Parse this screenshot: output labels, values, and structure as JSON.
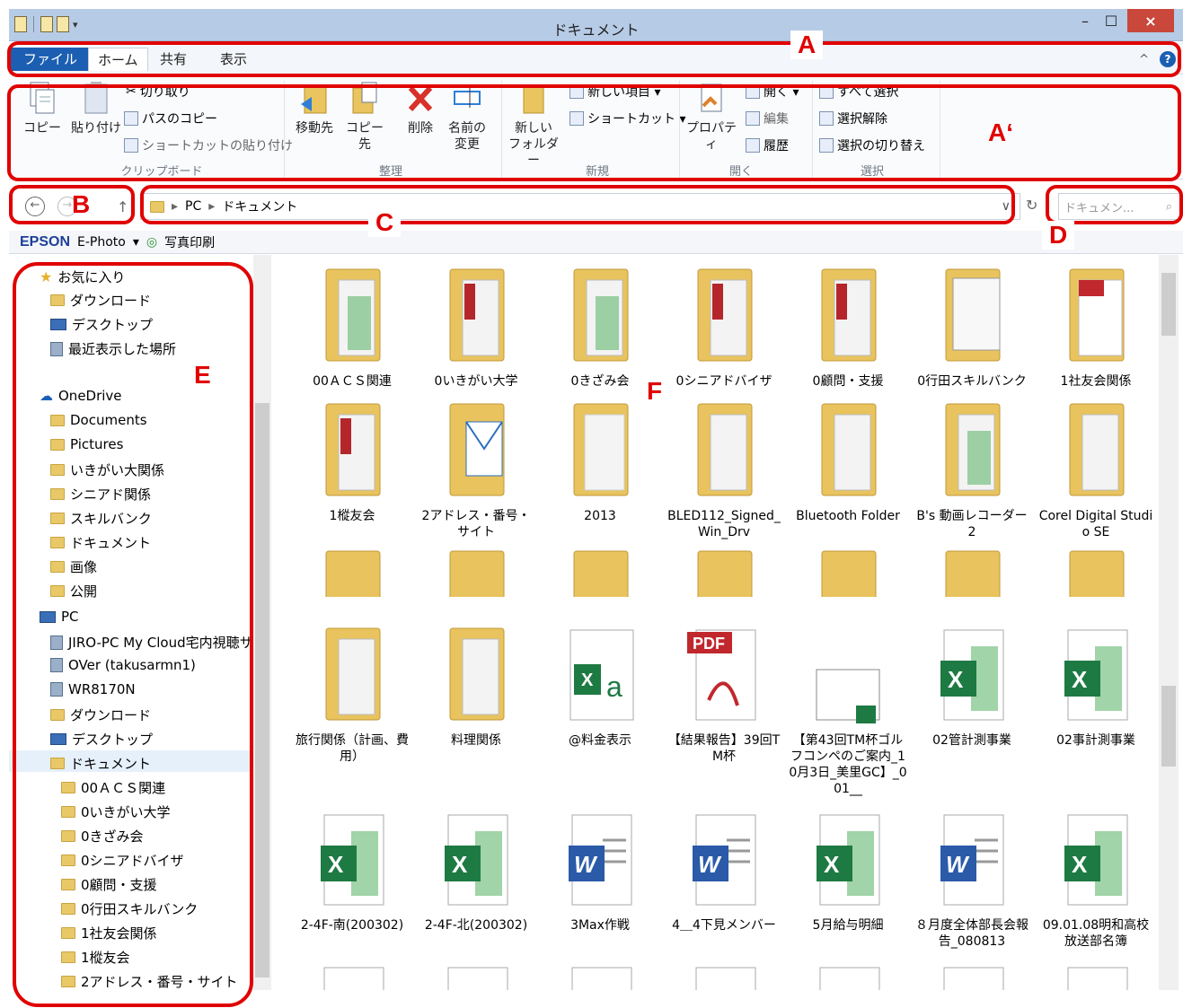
{
  "window": {
    "title": "ドキュメント",
    "close": "×",
    "minimize": "–",
    "maximize": "☐"
  },
  "ribbon_tabs": {
    "file": "ファイル",
    "home": "ホーム",
    "share": "共有",
    "view": "表示",
    "collapse": "^",
    "help": "?"
  },
  "ribbon": {
    "copy": "コピー",
    "paste": "貼り付け",
    "cut": "切り取り",
    "copy_path": "パスのコピー",
    "paste_shortcut": "ショートカットの貼り付け",
    "group_clipboard": "クリップボード",
    "move_to": "移動先",
    "copy_to": "コピー先",
    "delete": "削除",
    "rename_l1": "名前の",
    "rename_l2": "変更",
    "group_organize": "整理",
    "new_folder_l1": "新しい",
    "new_folder_l2": "フォルダー",
    "new_item": "新しい項目 ▾",
    "shortcut": "ショートカット ▾",
    "group_new": "新規",
    "properties": "プロパティ",
    "open": "開く ▾",
    "edit": "編集",
    "history": "履歴",
    "group_open": "開く",
    "select_all": "すべて選択",
    "select_none": "選択解除",
    "invert": "選択の切り替え",
    "group_select": "選択"
  },
  "address": {
    "back": "←",
    "forward": "→",
    "up": "↑",
    "path1": "PC",
    "sep": "▸",
    "path2": "ドキュメント",
    "dropdown": "∨",
    "refresh": "↻"
  },
  "search": {
    "placeholder": "ドキュメン...",
    "icon": "⌕"
  },
  "epson": {
    "brand": "EPSON",
    "app": "E-Photo",
    "dropdown": "▾",
    "print": "写真印刷"
  },
  "nav": {
    "favorites": "お気に入り",
    "downloads": "ダウンロード",
    "desktop": "デスクトップ",
    "recent": "最近表示した場所",
    "onedrive": "OneDrive",
    "od_items": [
      "Documents",
      "Pictures",
      "いきがい大関係",
      "シニアド関係",
      "スキルバンク",
      "ドキュメント",
      "画像",
      "公開"
    ],
    "pc": "PC",
    "pc_items": [
      "JIRO-PC My Cloud宅内視聴サ",
      "OVer (takusarmn1)",
      "WR8170N",
      "ダウンロード",
      "デスクトップ",
      "ドキュメント"
    ],
    "doc_items": [
      "00ＡＣＳ関連",
      "0いきがい大学",
      "0きざみ会",
      "0シニアドバイザ",
      "0顧問・支援",
      "0行田スキルバンク",
      "1社友会関係",
      "1樅友会",
      "2アドレス・番号・サイト"
    ]
  },
  "files": {
    "row1": [
      "00ＡＣＳ関連",
      "0いきがい大学",
      "0きざみ会",
      "0シニアドバイザ",
      "0顧問・支援",
      "0行田スキルバンク",
      "1社友会関係"
    ],
    "row2": [
      "1樅友会",
      "2アドレス・番号・サイト",
      "2013",
      "BLED112_Signed_Win_Drv",
      "Bluetooth Folder",
      "B's 動画レコーダー 2",
      "Corel Digital Studio SE"
    ],
    "row4": [
      "旅行関係（計画、費用）",
      "料理関係",
      "@料金表示",
      "【結果報告】39回TM杯",
      "【第43回TM杯ゴルフコンペのご案内_10月3日_美里GC】_001__",
      "02管計測事業",
      "02事計測事業"
    ],
    "row5": [
      "2-4F-南(200302)",
      "2-4F-北(200302)",
      "3Max作戦",
      "4＿4下見メンバー",
      "5月給与明細",
      "８月度全体部長会報告_080813",
      "09.01.08明和高校放送部名簿"
    ]
  },
  "annotations": {
    "a": "A",
    "a2": "A‘",
    "b": "B",
    "c": "C",
    "d": "D",
    "e": "E",
    "f": "F"
  }
}
